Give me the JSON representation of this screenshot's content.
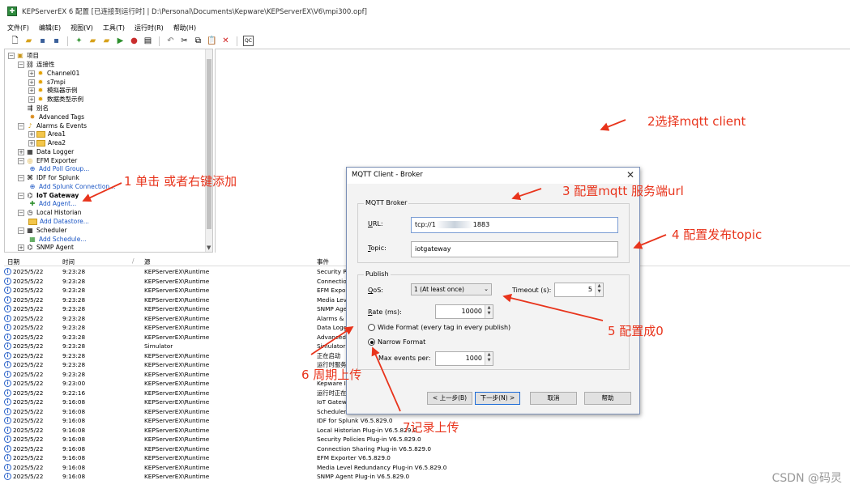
{
  "window": {
    "title": "KEPServerEX 6 配置 [已连接到运行时] | D:\\Personal\\Documents\\Kepware\\KEPServerEX\\V6\\mpi300.opf]",
    "icon": "kepserver-app-icon"
  },
  "menu": [
    "文件(F)",
    "编辑(E)",
    "视图(V)",
    "工具(T)",
    "运行时(R)",
    "帮助(H)"
  ],
  "tree": {
    "project": "项目",
    "connectivity": "连接性",
    "channel01": "Channel01",
    "s7mpi": "s7mpi",
    "simulator": "模拟器示例",
    "datatype": "数据类型示例",
    "alias": "别名",
    "advanced_tags": "Advanced Tags",
    "alarms_events": "Alarms & Events",
    "area1": "Area1",
    "area2": "Area2",
    "data_logger": "Data Logger",
    "efm_exporter": "EFM Exporter",
    "add_poll_group": "Add Poll Group...",
    "idf_splunk": "IDF for Splunk",
    "add_splunk": "Add Splunk Connection...",
    "iot_gateway": "IoT Gateway",
    "add_agent": "Add Agent...",
    "local_historian": "Local Historian",
    "add_datastore": "Add Datastore...",
    "scheduler": "Scheduler",
    "add_schedule": "Add Schedule...",
    "snmp_agent": "SNMP Agent"
  },
  "log": {
    "headers": {
      "date": "日期",
      "time": "时间",
      "source": "源",
      "event": "事件"
    },
    "rows": [
      {
        "date": "2025/5/22",
        "time": "9:23:28",
        "source": "KEPServerEX\\Runtime",
        "event": "Security Po"
      },
      {
        "date": "2025/5/22",
        "time": "9:23:28",
        "source": "KEPServerEX\\Runtime",
        "event": "Connection"
      },
      {
        "date": "2025/5/22",
        "time": "9:23:28",
        "source": "KEPServerEX\\Runtime",
        "event": "EFM Expor"
      },
      {
        "date": "2025/5/22",
        "time": "9:23:28",
        "source": "KEPServerEX\\Runtime",
        "event": "Media Leve"
      },
      {
        "date": "2025/5/22",
        "time": "9:23:28",
        "source": "KEPServerEX\\Runtime",
        "event": "SNMP Agen"
      },
      {
        "date": "2025/5/22",
        "time": "9:23:28",
        "source": "KEPServerEX\\Runtime",
        "event": "Alarms & Ev"
      },
      {
        "date": "2025/5/22",
        "time": "9:23:28",
        "source": "KEPServerEX\\Runtime",
        "event": "Data Logge"
      },
      {
        "date": "2025/5/22",
        "time": "9:23:28",
        "source": "KEPServerEX\\Runtime",
        "event": "Advanced"
      },
      {
        "date": "2025/5/22",
        "time": "9:23:28",
        "source": "Simulator",
        "event": "Simulator"
      },
      {
        "date": "2025/5/22",
        "time": "9:23:28",
        "source": "KEPServerEX\\Runtime",
        "event": "正在启动"
      },
      {
        "date": "2025/5/22",
        "time": "9:23:28",
        "source": "KEPServerEX\\Runtime",
        "event": "运行时服务"
      },
      {
        "date": "2025/5/22",
        "time": "9:23:28",
        "source": "KEPServerEX\\Runtime",
        "event": ""
      },
      {
        "date": "2025/5/22",
        "time": "9:23:00",
        "source": "KEPServerEX\\Runtime",
        "event": "Kepware Ir"
      },
      {
        "date": "2025/5/22",
        "time": "9:22:16",
        "source": "KEPServerEX\\Runtime",
        "event": "运行时正在"
      },
      {
        "date": "2025/5/22",
        "time": "9:16:08",
        "source": "KEPServerEX\\Runtime",
        "event": "IoT Gatewa"
      },
      {
        "date": "2025/5/22",
        "time": "9:16:08",
        "source": "KEPServerEX\\Runtime",
        "event": "Scheduler"
      },
      {
        "date": "2025/5/22",
        "time": "9:16:08",
        "source": "KEPServerEX\\Runtime",
        "event": "IDF for Splunk V6.5.829.0"
      },
      {
        "date": "2025/5/22",
        "time": "9:16:08",
        "source": "KEPServerEX\\Runtime",
        "event": "Local Historian Plug-in V6.5.829.0"
      },
      {
        "date": "2025/5/22",
        "time": "9:16:08",
        "source": "KEPServerEX\\Runtime",
        "event": "Security Policies Plug-in V6.5.829.0"
      },
      {
        "date": "2025/5/22",
        "time": "9:16:08",
        "source": "KEPServerEX\\Runtime",
        "event": "Connection Sharing Plug-in V6.5.829.0"
      },
      {
        "date": "2025/5/22",
        "time": "9:16:08",
        "source": "KEPServerEX\\Runtime",
        "event": "EFM Exporter V6.5.829.0"
      },
      {
        "date": "2025/5/22",
        "time": "9:16:08",
        "source": "KEPServerEX\\Runtime",
        "event": "Media Level Redundancy Plug-in V6.5.829.0"
      },
      {
        "date": "2025/5/22",
        "time": "9:16:08",
        "source": "KEPServerEX\\Runtime",
        "event": "SNMP Agent Plug-in V6.5.829.0"
      }
    ]
  },
  "dialog": {
    "title": "MQTT Client - Broker",
    "broker_group": "MQTT Broker",
    "url_label": "URL:",
    "url_value": "tcp://1",
    "url_suffix": "1883",
    "topic_label": "Topic:",
    "topic_value": "iotgateway",
    "publish_group": "Publish",
    "qos_label": "QoS:",
    "qos_value": "1 (At least once)",
    "timeout_label": "Timeout (s):",
    "timeout_value": "5",
    "rate_label": "Rate (ms):",
    "rate_value": "10000",
    "wide_format": "Wide Format (every tag in every publish)",
    "narrow_format": "Narrow Format",
    "max_events_label": "Max events per:",
    "max_events_value": "1000",
    "btn_back": "< 上一步(B)",
    "btn_next": "下一步(N) >",
    "btn_cancel": "取消",
    "btn_help": "帮助"
  },
  "annotations": {
    "n1": "1 单击 或者右键添加",
    "n2": "2选择mqtt client",
    "n3": "3 配置mqtt 服务端url",
    "n4": "4 配置发布topic",
    "n5": "5 配置成0",
    "n6": "6 周期上传",
    "n7": "7记录上传",
    "color": "#e8341c"
  },
  "watermark": "CSDN @码灵"
}
